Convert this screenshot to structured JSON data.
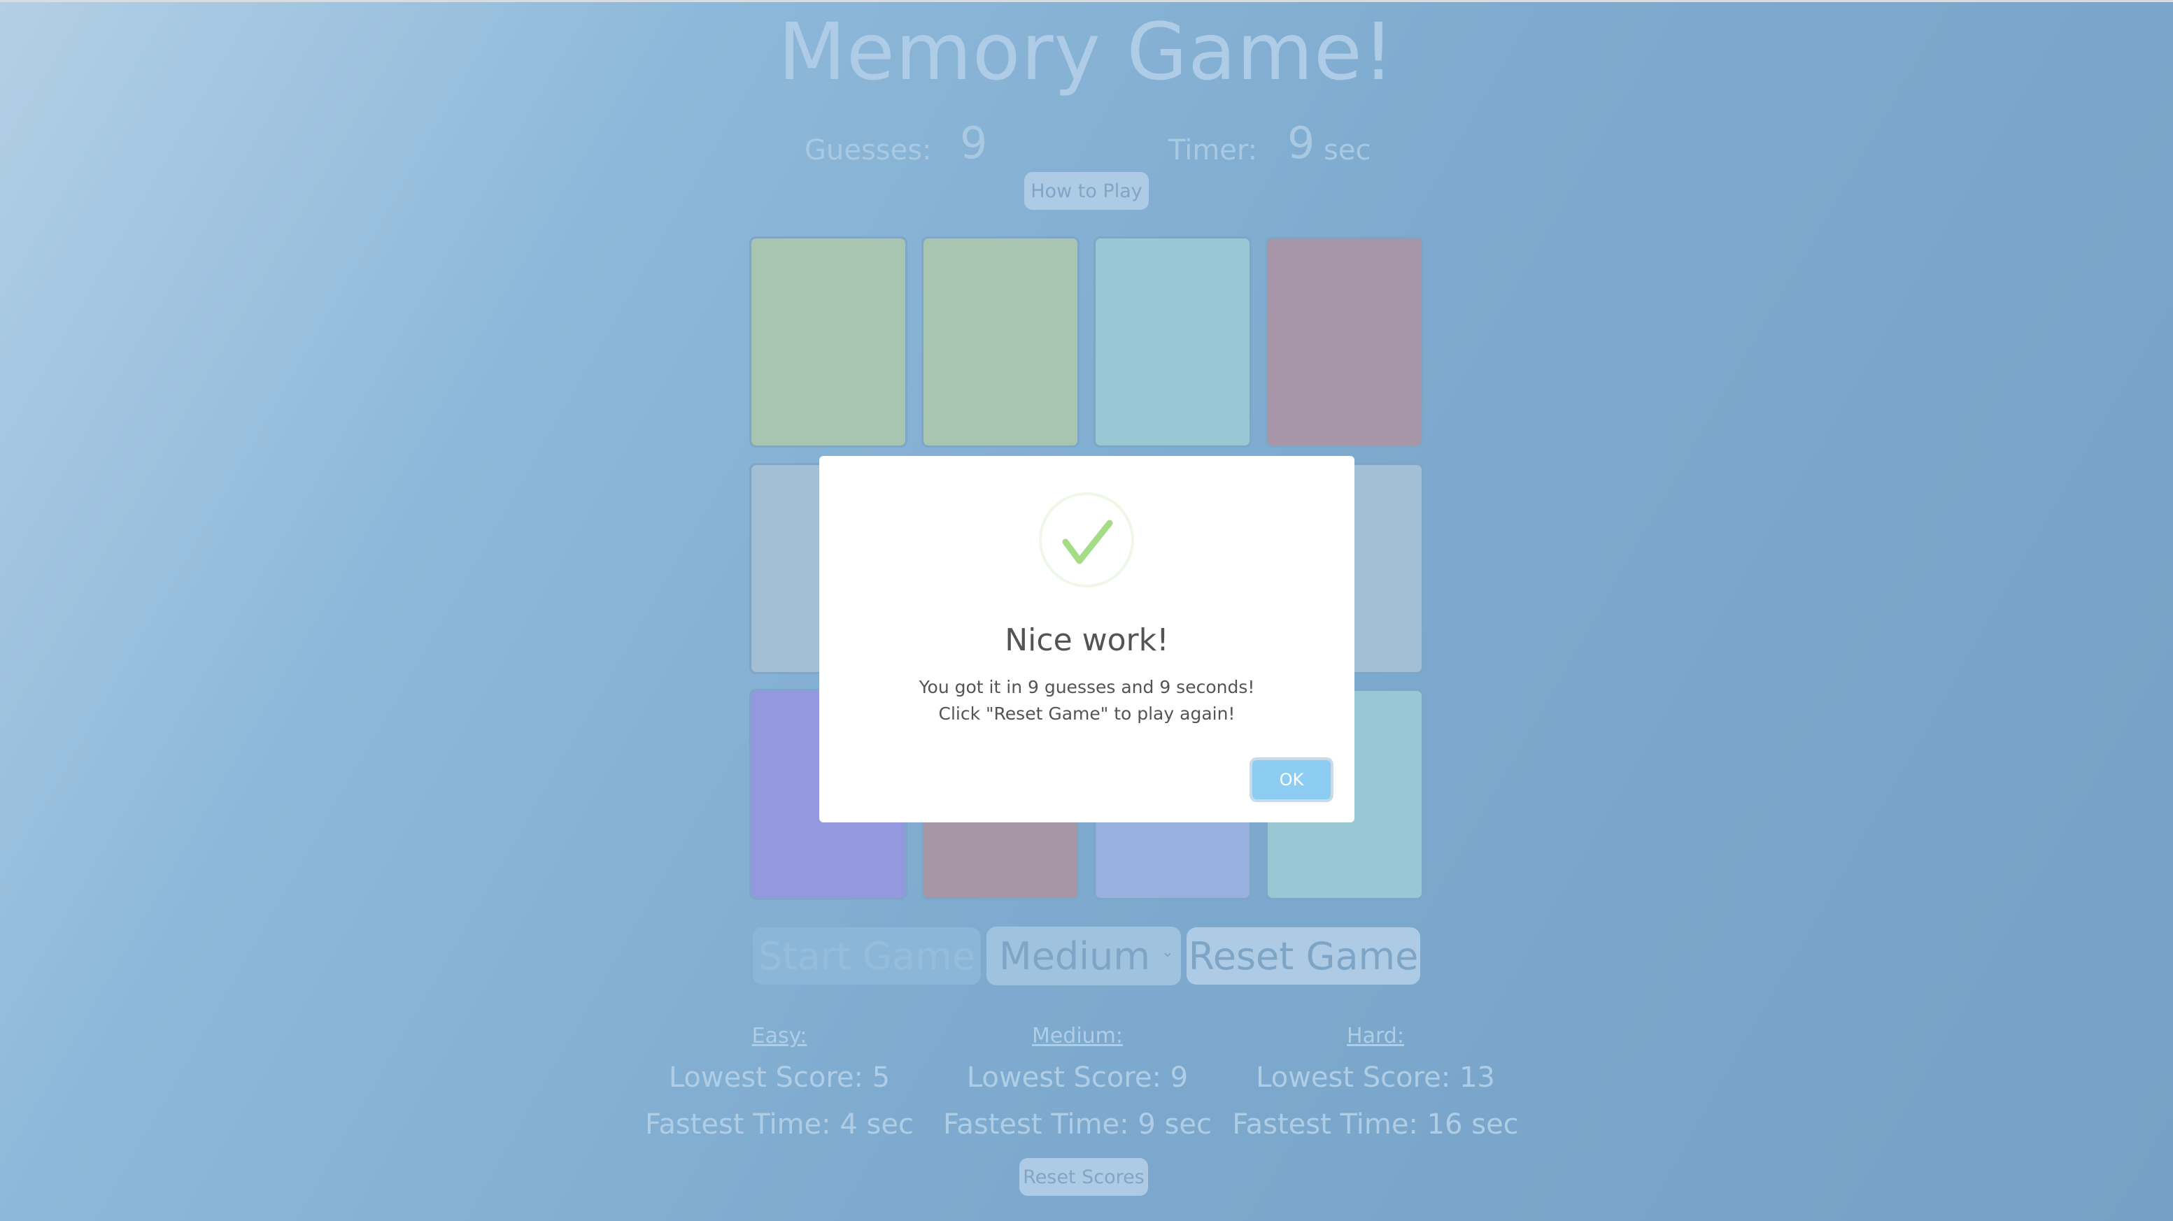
{
  "title": "Memory Game!",
  "status": {
    "guesses_label": "Guesses:",
    "guesses_value": "9",
    "timer_label": "Timer:",
    "timer_value": "9",
    "timer_unit": "sec"
  },
  "how_to_play_label": "How to Play",
  "cards": [
    {
      "color": "#a8c5b1"
    },
    {
      "color": "#a8c5b1"
    },
    {
      "color": "#99c8d4"
    },
    {
      "color": "#a696a8"
    },
    {
      "color": "#a3bfd5"
    },
    {
      "color": "#a3bfd5"
    },
    {
      "color": "#a3bfd5"
    },
    {
      "color": "#a3bfd5"
    },
    {
      "color": "#9398df"
    },
    {
      "color": "#a697a7"
    },
    {
      "color": "#97b1de"
    },
    {
      "color": "#99c8d4"
    }
  ],
  "controls": {
    "start_label": "Start Game",
    "difficulty_selected": "Medium",
    "reset_label": "Reset Game"
  },
  "scores": [
    {
      "level": "Easy:",
      "lowest": "Lowest Score: 5",
      "fastest": "Fastest Time: 4 sec"
    },
    {
      "level": "Medium:",
      "lowest": "Lowest Score: 9",
      "fastest": "Fastest Time: 9 sec"
    },
    {
      "level": "Hard:",
      "lowest": "Lowest Score: 13",
      "fastest": "Fastest Time: 16 sec"
    }
  ],
  "reset_scores_label": "Reset Scores",
  "modal": {
    "icon": "success-check-icon",
    "title": "Nice work!",
    "line1": "You got it in 9 guesses and 9 seconds!",
    "line2": "Click \"Reset Game\" to play again!",
    "ok_label": "OK",
    "accent": "#a5dc86"
  }
}
